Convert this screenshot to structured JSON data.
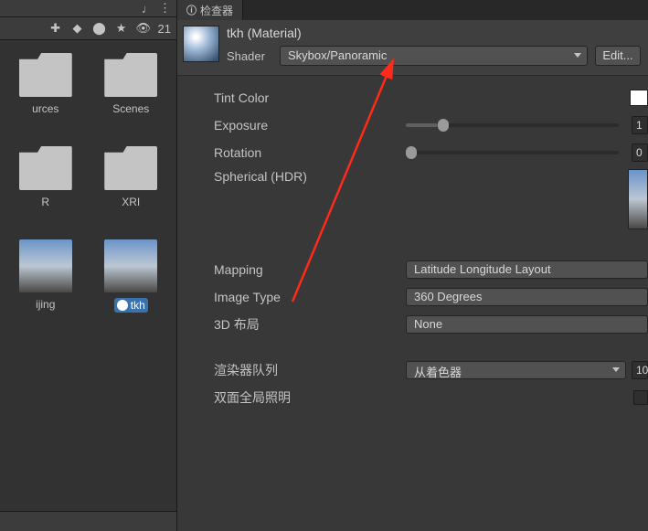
{
  "left": {
    "header_icons": [
      "♩",
      "⋮"
    ],
    "toolbar": {
      "hidden_count": "21"
    },
    "assets": [
      {
        "label": "urces",
        "type": "folder"
      },
      {
        "label": "Scenes",
        "type": "folder"
      },
      {
        "label": "R",
        "type": "folder"
      },
      {
        "label": "XRI",
        "type": "folder"
      },
      {
        "label": "ijing",
        "type": "image"
      },
      {
        "label": "tkh",
        "type": "material",
        "selected": true
      }
    ]
  },
  "tab": {
    "label": "检查器"
  },
  "material": {
    "name": "tkh",
    "type_suffix": "(Material)",
    "shader_label": "Shader",
    "shader_value": "Skybox/Panoramic",
    "edit_btn": "Edit..."
  },
  "props": {
    "tint": {
      "label": "Tint Color",
      "color": "#ffffff"
    },
    "exposure": {
      "label": "Exposure",
      "value": "1",
      "pct": 15
    },
    "rotation": {
      "label": "Rotation",
      "value": "0",
      "pct": 0
    },
    "spherical": {
      "label": "Spherical   (HDR)"
    },
    "mapping": {
      "label": "Mapping",
      "value": "Latitude Longitude Layout"
    },
    "image_type": {
      "label": "Image Type",
      "value": "360 Degrees"
    },
    "layout3d": {
      "label": "3D 布局",
      "value": "None"
    },
    "render_queue": {
      "label": "渲染器队列",
      "dd": "从着色器",
      "num": "10"
    },
    "gi": {
      "label": "双面全局照明"
    }
  }
}
